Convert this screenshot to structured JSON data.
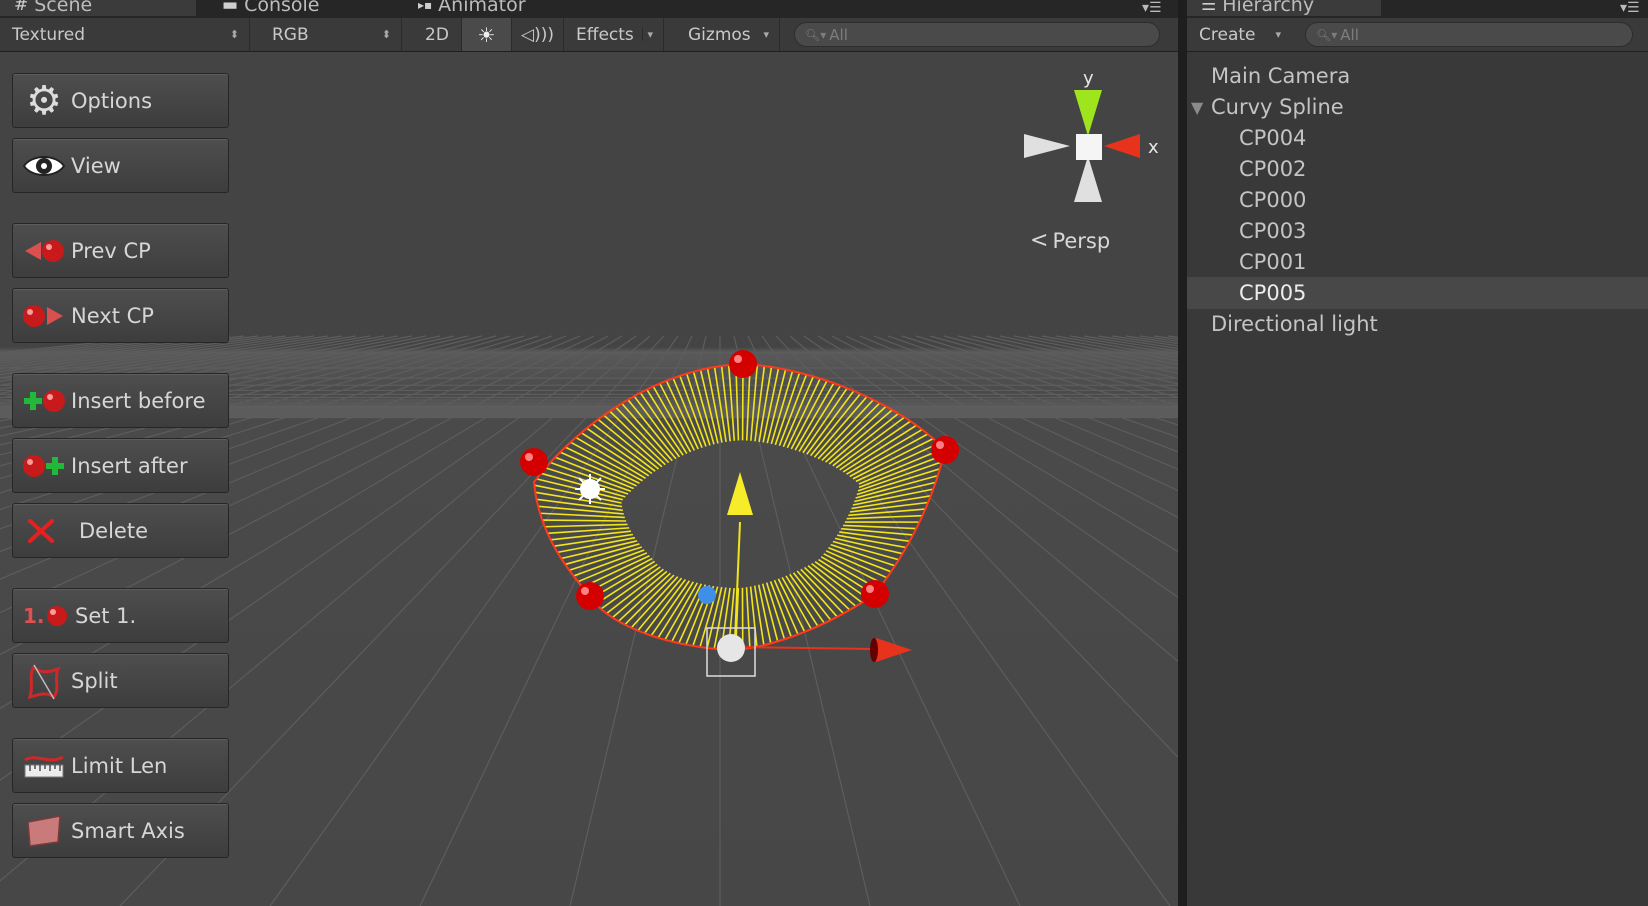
{
  "tabs": [
    {
      "label": "Scene",
      "icon": "grid-icon"
    },
    {
      "label": "Console",
      "icon": "console-icon"
    },
    {
      "label": "Animator",
      "icon": "animator-icon"
    },
    {
      "label": "Hierarchy",
      "icon": "list-icon"
    }
  ],
  "scene_toolbar": {
    "shading_mode": "Textured",
    "render_mode": "RGB",
    "mode_2d": "2D",
    "lighting_icon": "sun-icon",
    "audio_icon": "speaker-icon",
    "effects": "Effects",
    "gizmos": "Gizmos",
    "search_placeholder": "All"
  },
  "hierarchy_toolbar": {
    "create": "Create",
    "search_placeholder": "All"
  },
  "side_buttons": [
    {
      "label": "Options",
      "icon": "gear-icon"
    },
    {
      "label": "View",
      "icon": "eye-icon"
    },
    {
      "label": "Prev CP",
      "icon": "prev-cp-icon"
    },
    {
      "label": "Next CP",
      "icon": "next-cp-icon"
    },
    {
      "label": "Insert before",
      "icon": "insert-before-icon"
    },
    {
      "label": "Insert after",
      "icon": "insert-after-icon"
    },
    {
      "label": "Delete",
      "icon": "delete-x-icon"
    },
    {
      "label": "Set 1.",
      "icon": "set-first-icon",
      "icon_text": "1."
    },
    {
      "label": "Split",
      "icon": "split-icon"
    },
    {
      "label": "Limit Len",
      "icon": "ruler-icon"
    },
    {
      "label": "Smart Axis",
      "icon": "plane-icon"
    }
  ],
  "gizmo": {
    "y_label": "y",
    "x_label": "x",
    "projection": "Persp"
  },
  "hierarchy": {
    "items": [
      {
        "label": "Main Camera",
        "depth": 0,
        "selected": false
      },
      {
        "label": "Curvy Spline",
        "depth": 0,
        "expanded": true,
        "selected": false
      },
      {
        "label": "CP004",
        "depth": 1,
        "selected": false
      },
      {
        "label": "CP002",
        "depth": 1,
        "selected": false
      },
      {
        "label": "CP000",
        "depth": 1,
        "selected": false
      },
      {
        "label": "CP003",
        "depth": 1,
        "selected": false
      },
      {
        "label": "CP001",
        "depth": 1,
        "selected": false
      },
      {
        "label": "CP005",
        "depth": 1,
        "selected": true
      },
      {
        "label": "Directional light",
        "depth": 0,
        "selected": false
      }
    ]
  },
  "colors": {
    "spline": "#f2e51a",
    "control_point": "#d40000",
    "axis_x": "#e8331c",
    "axis_y": "#9fe51e",
    "handle_blue": "#3f8fe8"
  }
}
